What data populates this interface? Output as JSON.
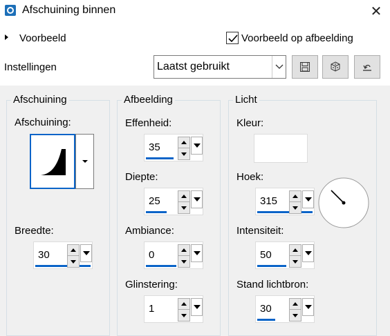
{
  "window": {
    "title": "Afschuining binnen",
    "close_glyph": "✕"
  },
  "preview": {
    "label": "Voorbeeld",
    "checkbox_label": "Voorbeeld op afbeelding",
    "checked": true
  },
  "settings": {
    "label": "Instellingen",
    "preset_value": "Laatst gebruikt"
  },
  "toolbar_icons": [
    "save-icon",
    "random-dice-icon",
    "reset-icon"
  ],
  "groups": {
    "bevel": {
      "title": "Afschuining",
      "shape_label": "Afschuining:",
      "width_label": "Breedte:",
      "width_value": "30"
    },
    "image": {
      "title": "Afbeelding",
      "smoothness_label": "Effenheid:",
      "smoothness_value": "35",
      "depth_label": "Diepte:",
      "depth_value": "25",
      "ambience_label": "Ambiance:",
      "ambience_value": "0",
      "shininess_label": "Glinstering:",
      "shininess_value": "1"
    },
    "light": {
      "title": "Licht",
      "color_label": "Kleur:",
      "color_value": "#ffffff",
      "angle_label": "Hoek:",
      "angle_value": "315",
      "intensity_label": "Intensiteit:",
      "intensity_value": "50",
      "elevation_label": "Stand lichtbron:",
      "elevation_value": "30"
    }
  },
  "colors": {
    "accent": "#0a64c8",
    "panel_bg": "#f0f0f0"
  }
}
